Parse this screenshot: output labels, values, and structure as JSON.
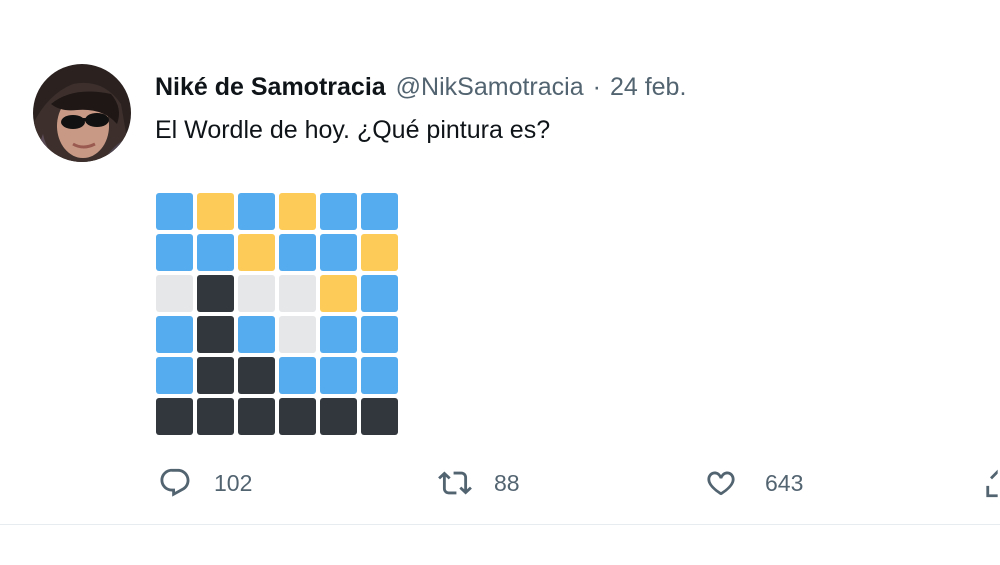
{
  "tweet": {
    "author_name": "Niké de Samotracia",
    "handle": "@NikSamotracia",
    "separator": "·",
    "date": "24 feb.",
    "text": "El Wordle de hoy. ¿Qué pintura es?"
  },
  "wordle": {
    "colors": {
      "B": "#55acee",
      "Y": "#fdcb58",
      "G": "#e6e7e8",
      "D": "#31373d"
    },
    "rows": [
      [
        "B",
        "Y",
        "B",
        "Y",
        "B",
        "B"
      ],
      [
        "B",
        "B",
        "Y",
        "B",
        "B",
        "Y"
      ],
      [
        "G",
        "D",
        "G",
        "G",
        "Y",
        "B"
      ],
      [
        "B",
        "D",
        "B",
        "G",
        "B",
        "B"
      ],
      [
        "B",
        "D",
        "D",
        "B",
        "B",
        "B"
      ],
      [
        "D",
        "D",
        "D",
        "D",
        "D",
        "D"
      ]
    ]
  },
  "actions": {
    "reply_count": "102",
    "retweet_count": "88",
    "like_count": "643",
    "reply_icon": "reply-icon",
    "retweet_icon": "retweet-icon",
    "like_icon": "heart-icon",
    "share_icon": "share-icon"
  }
}
